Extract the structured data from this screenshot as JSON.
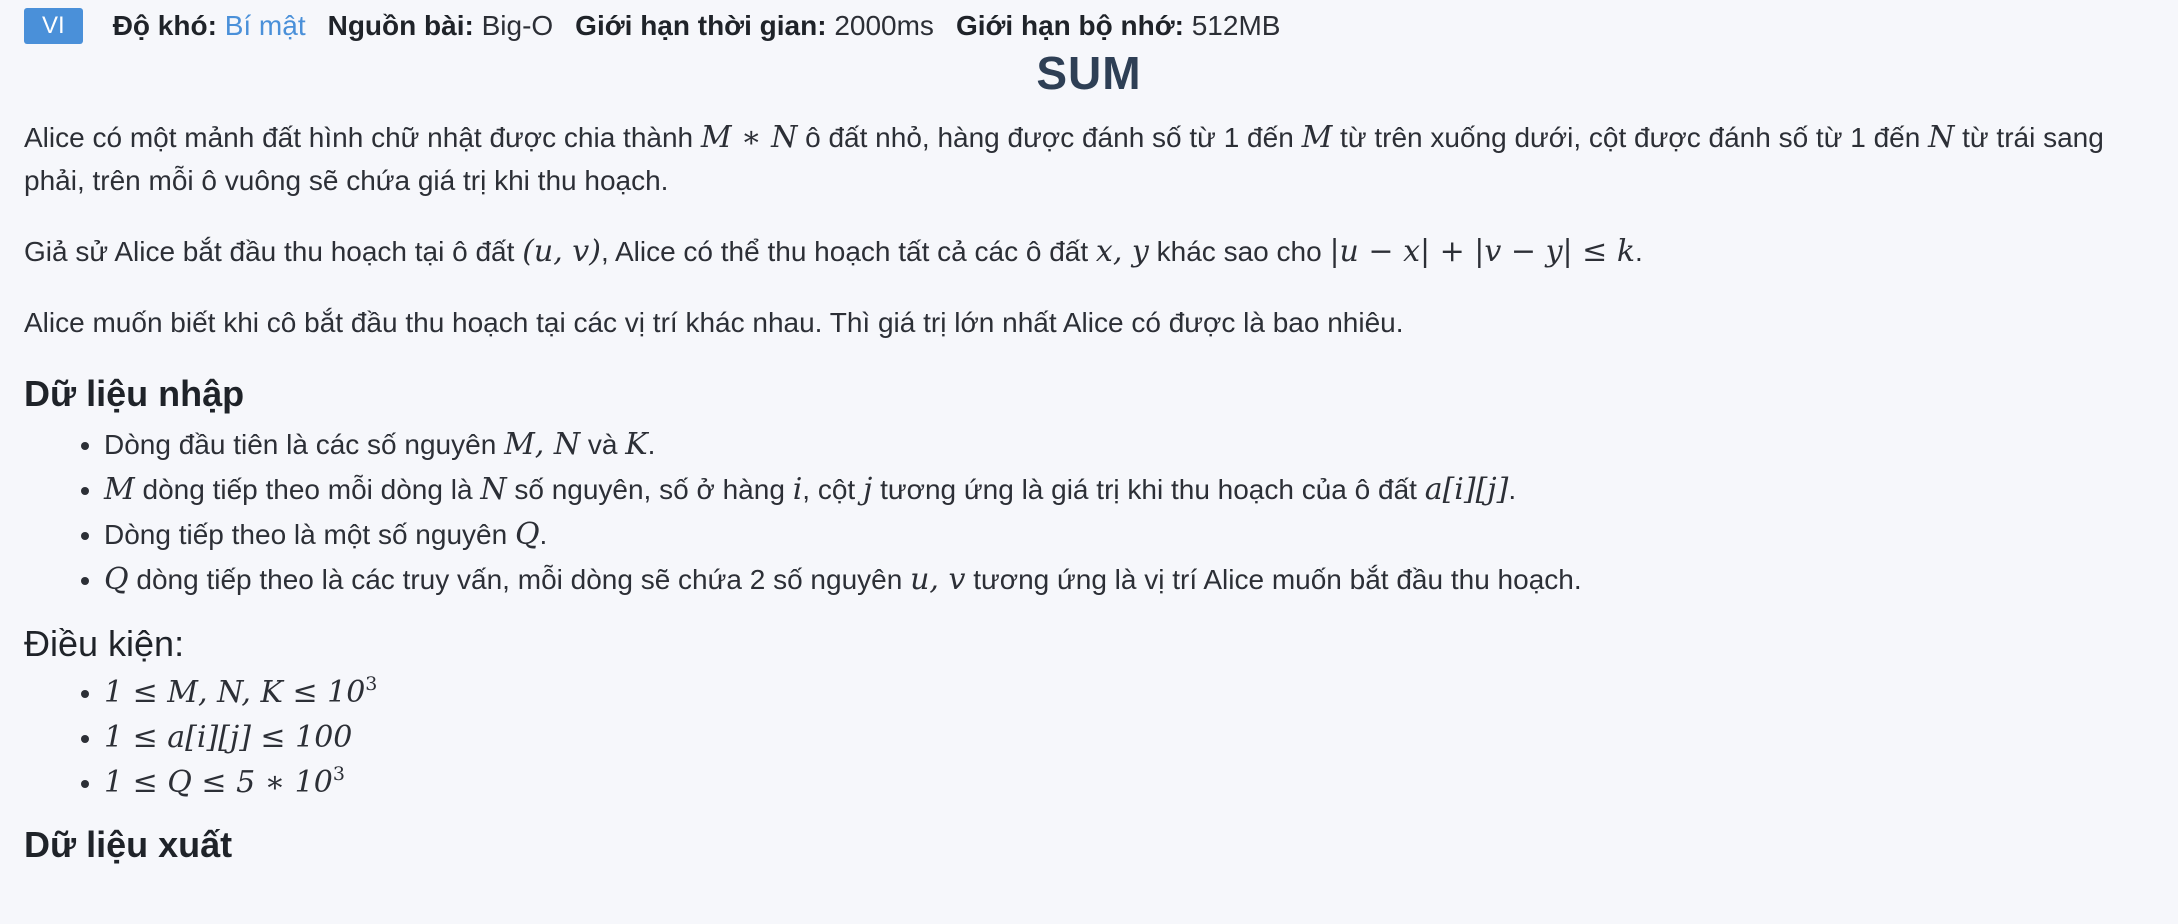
{
  "header": {
    "lang_badge": "VI",
    "difficulty_label": "Độ khó:",
    "difficulty_value": "Bí mật",
    "source_label": "Nguồn bài:",
    "source_value": "Big-O",
    "time_label": "Giới hạn thời gian:",
    "time_value": "2000ms",
    "memory_label": "Giới hạn bộ nhớ:",
    "memory_value": "512MB"
  },
  "problem": {
    "title": "SUM",
    "p1": {
      "a": "Alice có một mảnh đất hình chữ nhật được chia thành ",
      "m1": "M ∗ N",
      "b": " ô đất nhỏ, hàng được đánh số từ 1 đến ",
      "m2": "M",
      "c": " từ trên xuống dưới, cột được đánh số từ 1 đến ",
      "m3": "N",
      "d": " từ trái sang phải, trên mỗi ô vuông sẽ chứa giá trị khi thu hoạch."
    },
    "p2": {
      "a": "Giả sử Alice bắt đầu thu hoạch tại ô đất ",
      "m1": "(u, v)",
      "b": ", Alice có thể thu hoạch tất cả các ô đất ",
      "m2": "x, y",
      "c": " khác sao cho ",
      "m3": "|u − x| + |v − y| ≤ k",
      "d": "."
    },
    "p3": "Alice muốn biết khi cô bắt đầu thu hoạch tại các vị trí khác nhau. Thì giá trị lớn nhất Alice có được là bao nhiêu.",
    "input_heading": "Dữ liệu nhập",
    "input_items": {
      "i1": {
        "a": "Dòng đầu tiên là các số nguyên ",
        "m1": "M, N",
        "b": " và ",
        "m2": "K",
        "c": "."
      },
      "i2": {
        "m1": "M",
        "a": " dòng tiếp theo mỗi dòng là ",
        "m2": "N",
        "b": " số nguyên, số ở hàng ",
        "m3": "i",
        "c": ", cột ",
        "m4": "j",
        "d": " tương ứng là giá trị khi thu hoạch của ô đất ",
        "m5": "a[i][j]",
        "e": "."
      },
      "i3": {
        "a": "Dòng tiếp theo là một số nguyên ",
        "m1": "Q",
        "b": "."
      },
      "i4": {
        "m1": "Q",
        "a": " dòng tiếp theo là các truy vấn, mỗi dòng sẽ chứa 2 số nguyên ",
        "m2": "u, v",
        "b": " tương ứng là vị trí Alice muốn bắt đầu thu hoạch."
      }
    },
    "constraints_heading": "Điều kiện:",
    "constraints": {
      "c1": {
        "base": "1 ≤ M, N, K ≤ 10",
        "exp": "3"
      },
      "c2": {
        "base": "1 ≤ a[i][j] ≤ 100"
      },
      "c3": {
        "base": "1 ≤ Q ≤ 5 ∗ 10",
        "exp": "3"
      }
    },
    "output_heading": "Dữ liệu xuất"
  },
  "colors": {
    "badge": "#4a90d9",
    "link": "#4a90d9",
    "title": "#2e3f55",
    "background": "#f6f7fb"
  }
}
